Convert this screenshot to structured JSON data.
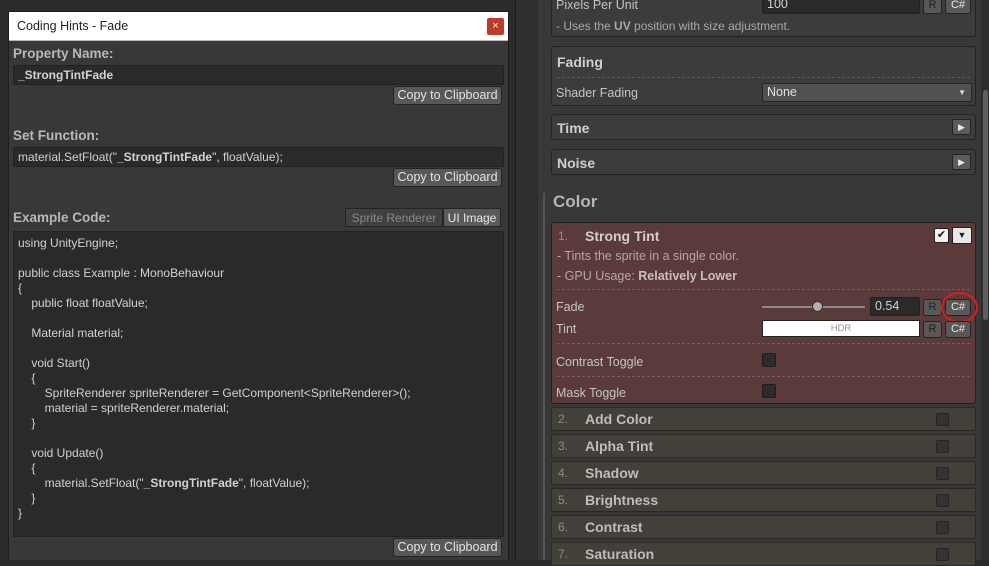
{
  "popup": {
    "title": "Coding Hints - Fade",
    "close_label": "×",
    "property_name_header": "Property Name:",
    "property_name_value": "_StrongTintFade",
    "copy_label": "Copy to Clipboard",
    "set_function_header": "Set Function:",
    "set_function_value": "material.SetFloat(\"_StrongTintFade\", floatValue);",
    "example_code_header": "Example Code:",
    "tabs": [
      "Sprite Renderer",
      "UI Image"
    ],
    "code_lines": [
      "using UnityEngine;",
      "",
      "public class Example : MonoBehaviour",
      "{",
      "    public float floatValue;",
      "",
      "    Material material;",
      "",
      "    void Start()",
      "    {",
      "        SpriteRenderer spriteRenderer = GetComponent<SpriteRenderer>();",
      "        material = spriteRenderer.material;",
      "    }",
      "",
      "    void Update()",
      "    {",
      "        material.SetFloat(\"_StrongTintFade\", floatValue);",
      "    }",
      "}"
    ]
  },
  "inspector": {
    "pixels_per_unit_label": "Pixels Per Unit",
    "pixels_per_unit_value": "100",
    "r_label": "R",
    "cs_label": "C#",
    "uv_note": "- Uses the UV position with size adjustment.",
    "fading_title": "Fading",
    "shader_fading_label": "Shader Fading",
    "shader_fading_value": "None",
    "time_title": "Time",
    "noise_title": "Noise",
    "color_title": "Color",
    "strong_tint": {
      "number": "1.",
      "name": "Strong Tint",
      "desc": "- Tints the sprite in a single color.",
      "gpu_prefix": "- GPU Usage: ",
      "gpu_value": "Relatively Lower",
      "fade_label": "Fade",
      "fade_value": "0.54",
      "fade_fraction": 0.54,
      "tint_label": "Tint",
      "tint_hdr": "HDR",
      "contrast_toggle_label": "Contrast Toggle",
      "mask_toggle_label": "Mask Toggle"
    },
    "effects": [
      {
        "number": "2.",
        "name": "Add Color"
      },
      {
        "number": "3.",
        "name": "Alpha Tint"
      },
      {
        "number": "4.",
        "name": "Shadow"
      },
      {
        "number": "5.",
        "name": "Brightness"
      },
      {
        "number": "6.",
        "name": "Contrast"
      },
      {
        "number": "7.",
        "name": "Saturation"
      }
    ]
  },
  "colors": {
    "highlight_red": "#e0191c",
    "strong_tint_bg": "#5a3a3a",
    "effect_item_bg": "#434039"
  }
}
